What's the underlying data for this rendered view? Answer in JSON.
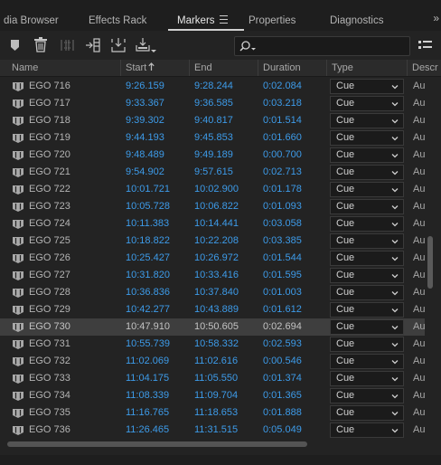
{
  "tabs": [
    {
      "label": "dia Browser"
    },
    {
      "label": "Effects Rack"
    },
    {
      "label": "Markers"
    },
    {
      "label": "Properties"
    },
    {
      "label": "Diagnostics"
    }
  ],
  "active_tab": "Markers",
  "more_icon": "»",
  "search": {
    "placeholder": "",
    "value": ""
  },
  "columns": {
    "name": "Name",
    "start": "Start",
    "end": "End",
    "duration": "Duration",
    "type": "Type",
    "description": "Descr"
  },
  "sort": {
    "column": "Start",
    "direction": "ascending"
  },
  "colors": {
    "timecode": "#3d9be9",
    "background": "#232323",
    "selected_row": "#3e3e3e"
  },
  "selected_row": "EGO 730",
  "markers": [
    {
      "name": "EGO 716",
      "start": "9:26.159",
      "end": "9:28.244",
      "duration": "0:02.084",
      "type": "Cue",
      "description": "Au"
    },
    {
      "name": "EGO 717",
      "start": "9:33.367",
      "end": "9:36.585",
      "duration": "0:03.218",
      "type": "Cue",
      "description": "Au"
    },
    {
      "name": "EGO 718",
      "start": "9:39.302",
      "end": "9:40.817",
      "duration": "0:01.514",
      "type": "Cue",
      "description": "Au"
    },
    {
      "name": "EGO 719",
      "start": "9:44.193",
      "end": "9:45.853",
      "duration": "0:01.660",
      "type": "Cue",
      "description": "Au"
    },
    {
      "name": "EGO 720",
      "start": "9:48.489",
      "end": "9:49.189",
      "duration": "0:00.700",
      "type": "Cue",
      "description": "Au"
    },
    {
      "name": "EGO 721",
      "start": "9:54.902",
      "end": "9:57.615",
      "duration": "0:02.713",
      "type": "Cue",
      "description": "Au"
    },
    {
      "name": "EGO 722",
      "start": "10:01.721",
      "end": "10:02.900",
      "duration": "0:01.178",
      "type": "Cue",
      "description": "Au"
    },
    {
      "name": "EGO 723",
      "start": "10:05.728",
      "end": "10:06.822",
      "duration": "0:01.093",
      "type": "Cue",
      "description": "Au"
    },
    {
      "name": "EGO 724",
      "start": "10:11.383",
      "end": "10:14.441",
      "duration": "0:03.058",
      "type": "Cue",
      "description": "Au"
    },
    {
      "name": "EGO 725",
      "start": "10:18.822",
      "end": "10:22.208",
      "duration": "0:03.385",
      "type": "Cue",
      "description": "Au"
    },
    {
      "name": "EGO 726",
      "start": "10:25.427",
      "end": "10:26.972",
      "duration": "0:01.544",
      "type": "Cue",
      "description": "Au"
    },
    {
      "name": "EGO 727",
      "start": "10:31.820",
      "end": "10:33.416",
      "duration": "0:01.595",
      "type": "Cue",
      "description": "Au"
    },
    {
      "name": "EGO 728",
      "start": "10:36.836",
      "end": "10:37.840",
      "duration": "0:01.003",
      "type": "Cue",
      "description": "Au"
    },
    {
      "name": "EGO 729",
      "start": "10:42.277",
      "end": "10:43.889",
      "duration": "0:01.612",
      "type": "Cue",
      "description": "Au"
    },
    {
      "name": "EGO 730",
      "start": "10:47.910",
      "end": "10:50.605",
      "duration": "0:02.694",
      "type": "Cue",
      "description": "Au"
    },
    {
      "name": "EGO 731",
      "start": "10:55.739",
      "end": "10:58.332",
      "duration": "0:02.593",
      "type": "Cue",
      "description": "Au"
    },
    {
      "name": "EGO 732",
      "start": "11:02.069",
      "end": "11:02.616",
      "duration": "0:00.546",
      "type": "Cue",
      "description": "Au"
    },
    {
      "name": "EGO 733",
      "start": "11:04.175",
      "end": "11:05.550",
      "duration": "0:01.374",
      "type": "Cue",
      "description": "Au"
    },
    {
      "name": "EGO 734",
      "start": "11:08.339",
      "end": "11:09.704",
      "duration": "0:01.365",
      "type": "Cue",
      "description": "Au"
    },
    {
      "name": "EGO 735",
      "start": "11:16.765",
      "end": "11:18.653",
      "duration": "0:01.888",
      "type": "Cue",
      "description": "Au"
    },
    {
      "name": "EGO 736",
      "start": "11:26.465",
      "end": "11:31.515",
      "duration": "0:05.049",
      "type": "Cue",
      "description": "Au"
    }
  ],
  "icons": [
    "marker-icon",
    "trash-icon",
    "merge-markers-icon",
    "insert-to-playlist-icon",
    "export-selected-icon",
    "batch-export-icon",
    "search-icon",
    "filter-icon",
    "menu-icon",
    "sort-up-icon",
    "cue-marker-icon",
    "chevron-down-icon"
  ]
}
